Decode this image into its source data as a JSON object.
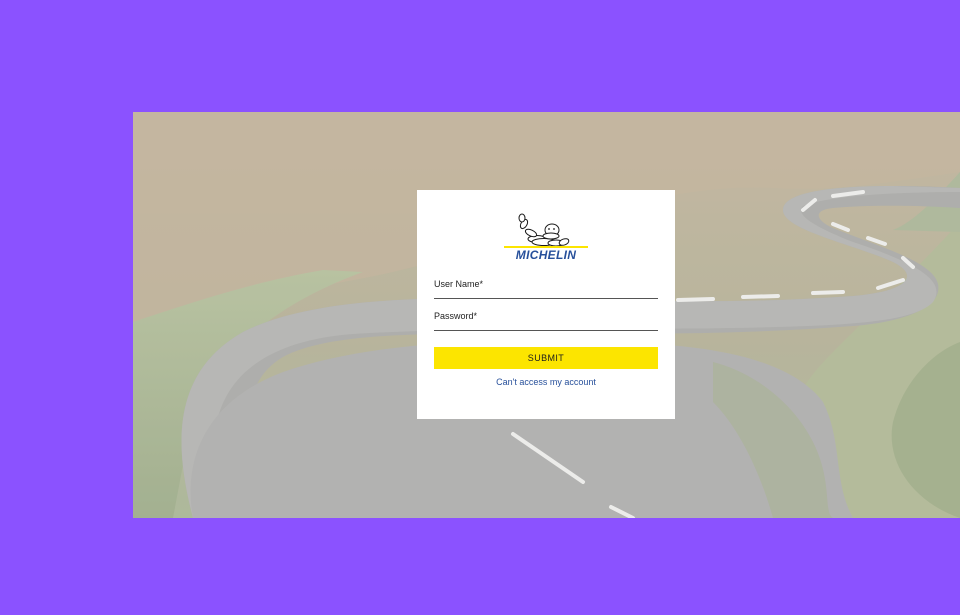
{
  "theme": {
    "backdrop_color": "#8b52ff",
    "card_background": "#ffffff",
    "submit_color": "#fce500",
    "link_color": "#27509b",
    "brand_color": "#27509b"
  },
  "background": {
    "icon": "winding-road-photo"
  },
  "login": {
    "logo": {
      "icon": "michelin-bibendum-icon",
      "wordmark": "MICHELIN"
    },
    "username": {
      "label": "User Name*",
      "value": ""
    },
    "password": {
      "label": "Password*",
      "value": ""
    },
    "submit_label": "SUBMIT",
    "help_link": "Can't access my account"
  }
}
